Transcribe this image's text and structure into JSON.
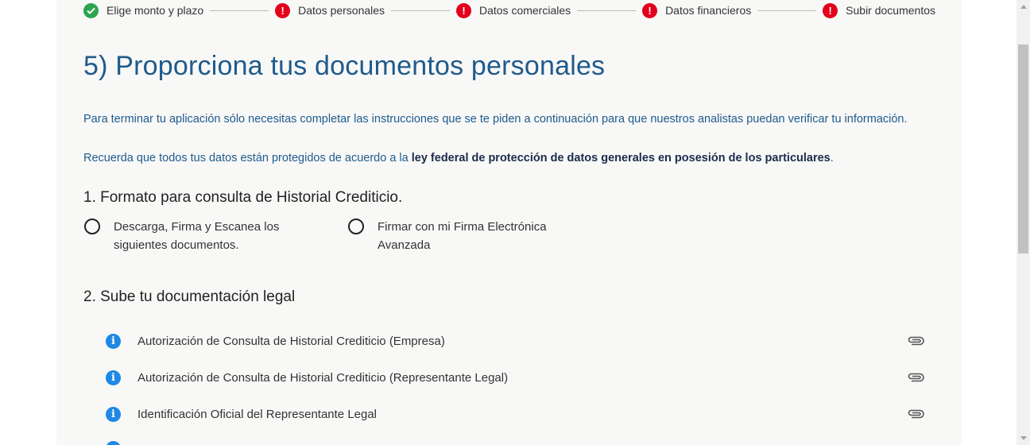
{
  "stepper": {
    "steps": [
      {
        "label": "Elige monto y plazo",
        "status": "complete"
      },
      {
        "label": "Datos personales",
        "status": "error"
      },
      {
        "label": "Datos comerciales",
        "status": "error"
      },
      {
        "label": "Datos financieros",
        "status": "error"
      },
      {
        "label": "Subir documentos",
        "status": "error"
      }
    ],
    "error_glyph": "!"
  },
  "page": {
    "title": "5) Proporciona tus documentos personales",
    "intro": "Para terminar tu aplicación sólo necesitas completar las instrucciones que se te piden a continuación para que nuestros analistas puedan verificar tu información.",
    "privacy_prefix": "Recuerda que todos tus datos están protegidos de acuerdo a la ",
    "privacy_bold": "ley federal de protección de datos generales en posesión de los particulares",
    "privacy_suffix": "."
  },
  "section1": {
    "title": "1. Formato para consulta de Historial Crediticio.",
    "options": [
      {
        "label": "Descarga, Firma y Escanea los siguientes documentos."
      },
      {
        "label": "Firmar con mi Firma Electrónica Avanzada"
      }
    ]
  },
  "section2": {
    "title": "2. Sube tu documentación legal",
    "info_glyph": "i",
    "documents": [
      {
        "label": "Autorización de Consulta de Historial Crediticio (Empresa)"
      },
      {
        "label": "Autorización de Consulta de Historial Crediticio (Representante Legal)"
      },
      {
        "label": "Identificación Oficial del Representante Legal"
      }
    ]
  },
  "colors": {
    "accent_blue": "#1f5b8c",
    "success_green": "#2ea44f",
    "error_red": "#e3001b",
    "info_blue": "#1e88e5"
  },
  "icons": {
    "complete": "check-circle-icon",
    "error": "exclamation-circle-icon",
    "info": "info-circle-icon",
    "attach": "paperclip-icon"
  }
}
